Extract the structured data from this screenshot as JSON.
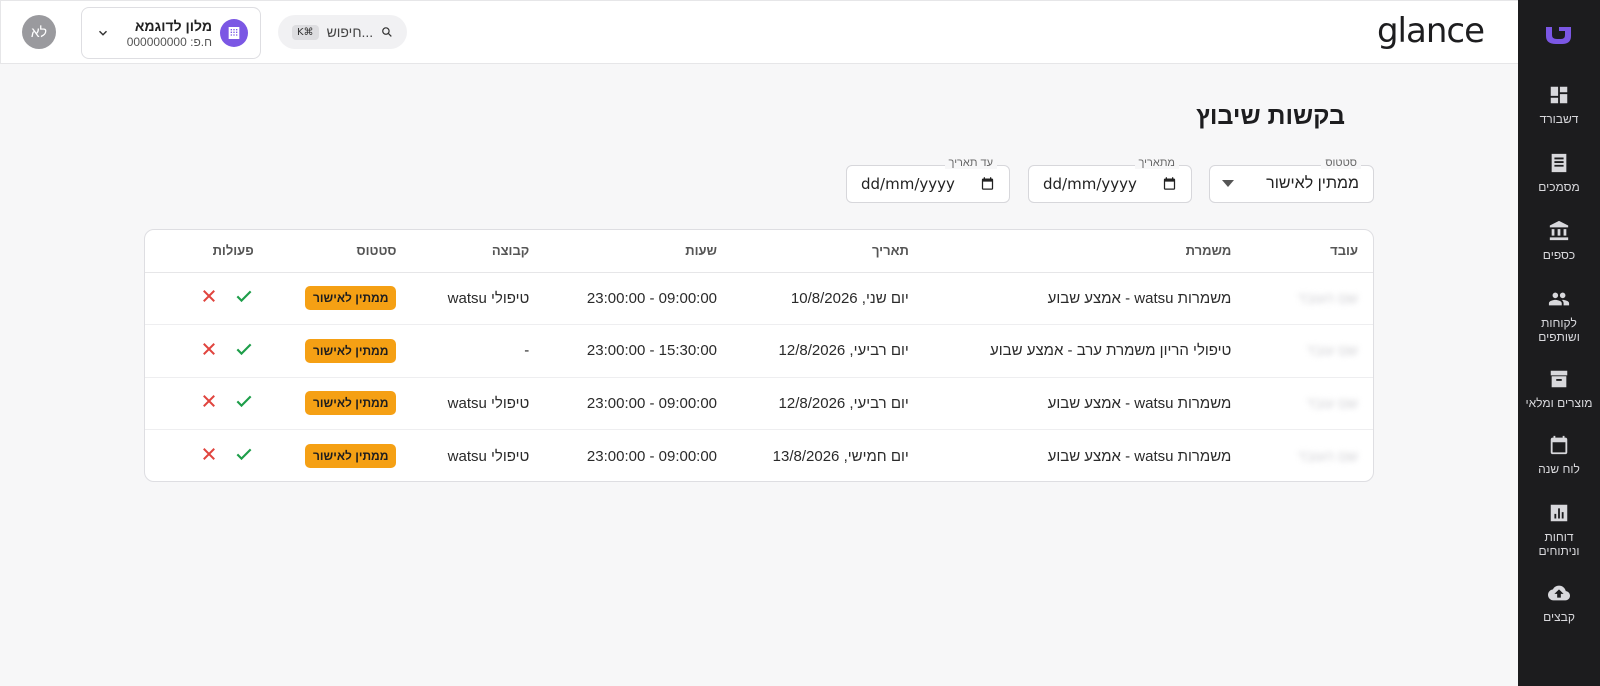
{
  "app": {
    "brand": "glance"
  },
  "topbar": {
    "user_initials": "לא",
    "hotel_name": "מלון לדוגמא",
    "hotel_phone": "ח.פ: 000000000",
    "search_placeholder": "חיפוש...",
    "search_shortcut": "K⌘"
  },
  "sidebar": {
    "items": [
      {
        "label": "דשבורד",
        "icon": "dashboard-icon"
      },
      {
        "label": "מסמכים",
        "icon": "document-icon"
      },
      {
        "label": "כספים",
        "icon": "bank-icon"
      },
      {
        "label": "לקוחות ושותפים",
        "icon": "people-icon"
      },
      {
        "label": "מוצרים ומלאי",
        "icon": "archive-icon"
      },
      {
        "label": "לוח שנה",
        "icon": "calendar-icon"
      },
      {
        "label": "דוחות וניתוחים",
        "icon": "chart-icon"
      },
      {
        "label": "קבצים",
        "icon": "cloud-upload-icon"
      }
    ]
  },
  "page": {
    "title": "בקשות שיבוץ"
  },
  "filters": {
    "status_label": "סטטוס",
    "status_value": "ממתין לאישור",
    "from_label": "מתאריך",
    "from_value": "dd/mm/yyyy",
    "to_label": "עד תאריך",
    "to_value": "dd/mm/yyyy"
  },
  "table": {
    "headers": {
      "employee": "עובד",
      "shift": "משמרת",
      "date": "תאריך",
      "hours": "שעות",
      "group": "קבוצה",
      "status": "סטטוס",
      "actions": "פעולות"
    },
    "rows": [
      {
        "employee": "שם העובד",
        "shift": "משמרות watsu - אמצע שבוע",
        "date": "יום שני, 10/8/2026",
        "hours": "09:00:00 - 23:00:00",
        "group": "טיפולי watsu",
        "status": "ממתין לאישור"
      },
      {
        "employee": "שם עובד",
        "shift": "טיפולי הריון משמרת ערב - אמצע שבוע",
        "date": "יום רביעי, 12/8/2026",
        "hours": "15:30:00 - 23:00:00",
        "group": "-",
        "status": "ממתין לאישור"
      },
      {
        "employee": "שם עובד",
        "shift": "משמרות watsu - אמצע שבוע",
        "date": "יום רביעי, 12/8/2026",
        "hours": "09:00:00 - 23:00:00",
        "group": "טיפולי watsu",
        "status": "ממתין לאישור"
      },
      {
        "employee": "שם העובד",
        "shift": "משמרות watsu - אמצע שבוע",
        "date": "יום חמישי, 13/8/2026",
        "hours": "09:00:00 - 23:00:00",
        "group": "טיפולי watsu",
        "status": "ממתין לאישור"
      }
    ]
  },
  "colors": {
    "sidebar_bg": "#1c1c1e",
    "accent_purple": "#7b57e4",
    "badge_orange": "#f5a014",
    "approve_green": "#1e9e4a",
    "reject_red": "#e0443e"
  }
}
